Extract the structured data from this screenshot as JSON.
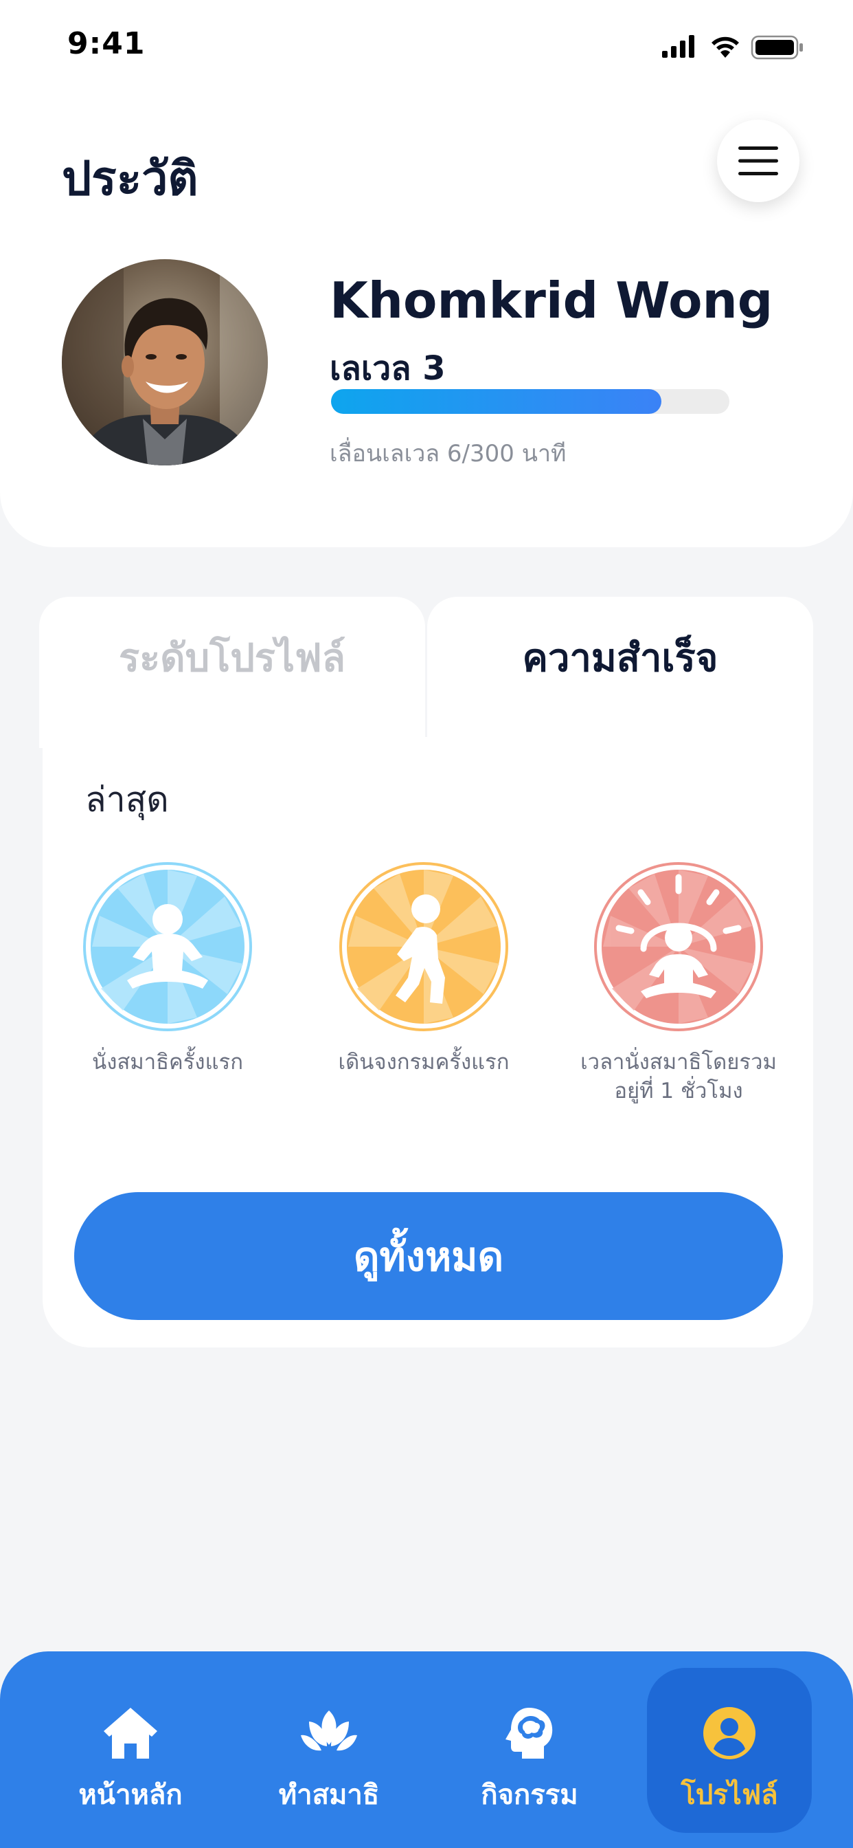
{
  "status_bar": {
    "time": "9:41"
  },
  "header": {
    "title": "ประวัติ",
    "user_name": "Khomkrid Wong",
    "level_label": "เลเวล 3",
    "level_progress_fraction": 0.83,
    "progress_caption": "เลื่อนเลเวล 6/300 นาที"
  },
  "tabs": [
    {
      "label": "ระดับโปรไฟล์",
      "active": false
    },
    {
      "label": "ความสำเร็จ",
      "active": true
    }
  ],
  "achievements": {
    "section_label": "ล่าสุด",
    "items": [
      {
        "icon": "meditation-icon",
        "label_line1": "นั่งสมาธิครั้งแรก",
        "label_line2": "",
        "color": "#8dd8fa"
      },
      {
        "icon": "walking-meditation-icon",
        "label_line1": "เดินจงกรมครั้งแรก",
        "label_line2": "",
        "color": "#fcbf5a"
      },
      {
        "icon": "enlightened-meditation-icon",
        "label_line1": "เวลานั่งสมาธิโดยรวม",
        "label_line2": "อยู่ที่ 1 ชั่วโมง",
        "color": "#ee938c"
      }
    ],
    "view_all_label": "ดูทั้งหมด"
  },
  "bottom_nav": [
    {
      "label": "หน้าหลัก",
      "icon": "home-icon",
      "active": false
    },
    {
      "label": "ทำสมาธิ",
      "icon": "lotus-icon",
      "active": false
    },
    {
      "label": "กิจกรรม",
      "icon": "brain-head-icon",
      "active": false
    },
    {
      "label": "โปรไฟล์",
      "icon": "user-icon",
      "active": true
    }
  ],
  "colors": {
    "primary": "#2f80e8",
    "nav_active_bg": "#1e69d6",
    "nav_active_text": "#f7c23c",
    "text_dark": "#0f1933",
    "tab_inactive": "#c4c6cb"
  }
}
